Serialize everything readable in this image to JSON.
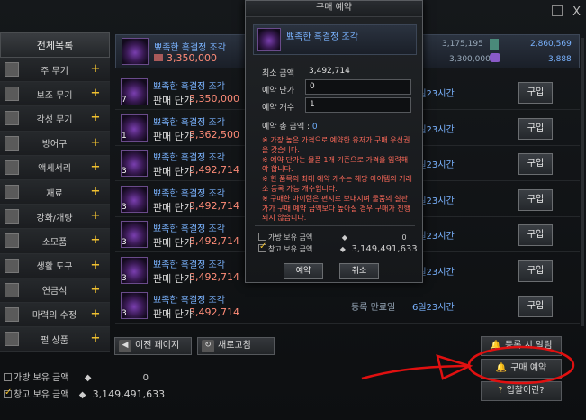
{
  "window": {
    "close_glyph": "X"
  },
  "sidebar": {
    "header": "전체목록",
    "items": [
      {
        "label": "주 무기",
        "icon": "sword-icon"
      },
      {
        "label": "보조 무기",
        "icon": "shield-icon"
      },
      {
        "label": "각성 무기",
        "icon": "awakening-weapon-icon"
      },
      {
        "label": "방어구",
        "icon": "armor-icon"
      },
      {
        "label": "액세서리",
        "icon": "ring-icon"
      },
      {
        "label": "재료",
        "icon": "material-icon"
      },
      {
        "label": "강화/개량",
        "icon": "enhance-icon"
      },
      {
        "label": "소모품",
        "icon": "potion-icon"
      },
      {
        "label": "생활 도구",
        "icon": "tool-icon"
      },
      {
        "label": "연금석",
        "icon": "alchemy-stone-icon"
      },
      {
        "label": "마력의 수정",
        "icon": "crystal-icon"
      },
      {
        "label": "펄 상품",
        "icon": "pearl-icon"
      }
    ],
    "plus_glyph": "+"
  },
  "top_item": {
    "name": "뾰족한 흑결정 조각",
    "price": "3,350,000",
    "stat1": "3,175,195",
    "stat2": "3,300,000",
    "stat3": "2,860,569",
    "stat4": "3,888"
  },
  "listings": [
    {
      "qty": "7",
      "name": "뾰족한 흑결정 조각",
      "price_label": "판매 단가",
      "price": "3,350,000",
      "remain": "6일23시간",
      "buy": "구입"
    },
    {
      "qty": "1",
      "name": "뾰족한 흑결정 조각",
      "price_label": "판매 단가",
      "price": "3,362,500",
      "remain": "6일23시간",
      "buy": "구입"
    },
    {
      "qty": "3",
      "name": "뾰족한 흑결정 조각",
      "price_label": "판매 단가",
      "price": "3,492,714",
      "remain": "6일23시간",
      "buy": "구입"
    },
    {
      "qty": "3",
      "name": "뾰족한 흑결정 조각",
      "price_label": "판매 단가",
      "price": "3,492,714",
      "remain": "6일23시간",
      "buy": "구입"
    },
    {
      "qty": "3",
      "name": "뾰족한 흑결정 조각",
      "price_label": "판매 단가",
      "price": "3,492,714",
      "remain": "6일23시간",
      "buy": "구입"
    },
    {
      "qty": "3",
      "name": "뾰족한 흑결정 조각",
      "price_label": "판매 단가",
      "price": "3,492,714",
      "remain": "6일23시간",
      "buy": "구입"
    },
    {
      "qty": "3",
      "name": "뾰족한 흑결정 조각",
      "price_label": "판매 단가",
      "price": "3,492,714",
      "remain": "6일23시간",
      "buy": "구입",
      "end_label": "등록 만료일"
    }
  ],
  "bottom": {
    "prev_page": "이전 페이지",
    "refresh": "새로고침",
    "inventory_label": "가방 보유 금액",
    "inventory_value": "0",
    "warehouse_label": "창고 보유 금액",
    "warehouse_value": "3,149,491,633",
    "notify_btn": "등록 시 알림",
    "reserve_btn": "구매 예약",
    "help_btn": "입찰이란?"
  },
  "modal": {
    "title": "구매 예약",
    "item_name": "뾰족한 흑결정 조각",
    "min_price_label": "최소 금액",
    "min_price_value": "3,492,714",
    "unit_price_label": "예약 단가",
    "unit_price_value": "0",
    "count_label": "예약 개수",
    "count_value": "1",
    "total_label": "예약 총 금액 :",
    "total_value": "0",
    "notes": [
      "※ 가장 높은 가격으로 예약한 유저가 구매 우선권을 갖습니다.",
      "※ 예약 단가는 물품 1개 기준으로 가격을 입력해야 합니다.",
      "※ 한 품목의 최대 예약 개수는 해당 아이템의 거래소 등록 가능 개수입니다.",
      "※ 구매한 아이템은 편지로 보내지며 물품의 실판가가 구매 예약 금액보다 높아질 경우 구매가 진행되지 않습니다."
    ],
    "bag_label": "가방 보유 금액",
    "bag_value": "0",
    "wh_label": "창고 보유 금액",
    "wh_value": "3,149,491,633",
    "confirm": "예약",
    "cancel": "취소"
  },
  "colors": {
    "price_red": "#ff8c78",
    "name_blue": "#7ab3ff",
    "annotation_red": "#e01010"
  }
}
